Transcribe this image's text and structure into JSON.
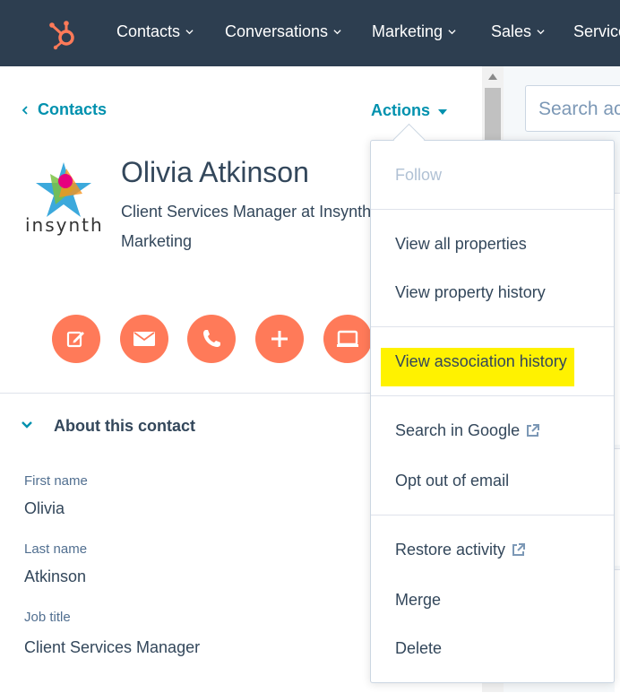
{
  "nav": {
    "items": [
      {
        "label": "Contacts"
      },
      {
        "label": "Conversations"
      },
      {
        "label": "Marketing"
      },
      {
        "label": "Sales"
      },
      {
        "label": "Service"
      }
    ]
  },
  "record": {
    "back_label": "Contacts",
    "actions_label": "Actions",
    "name": "Olivia Atkinson",
    "subtitle": "Client Services Manager at Insynth Marketing",
    "company_logo_text": "insynth"
  },
  "right_panel": {
    "search_placeholder": "Search ac"
  },
  "about": {
    "title": "About this contact",
    "fields": [
      {
        "label": "First name",
        "value": "Olivia"
      },
      {
        "label": "Last name",
        "value": "Atkinson"
      },
      {
        "label": "Job title",
        "value": "Client Services Manager"
      }
    ]
  },
  "actions_menu": {
    "items": [
      {
        "label": "Follow",
        "disabled": true
      },
      {
        "label": "View all properties"
      },
      {
        "label": "View property history"
      },
      {
        "label": "View association history",
        "highlighted": true
      },
      {
        "label": "Search in Google",
        "external": true
      },
      {
        "label": "Opt out of email"
      },
      {
        "label": "Restore activity",
        "external": true
      },
      {
        "label": "Merge"
      },
      {
        "label": "Delete"
      }
    ]
  },
  "colors": {
    "nav_bg": "#2d3e50",
    "accent": "#0091ae",
    "action_button": "#ff7a59",
    "highlight": "#fff200",
    "brand_orange": "#ff7a59"
  },
  "icons": {
    "action_buttons": [
      "note-icon",
      "email-icon",
      "call-icon",
      "add-icon",
      "meeting-icon"
    ]
  }
}
